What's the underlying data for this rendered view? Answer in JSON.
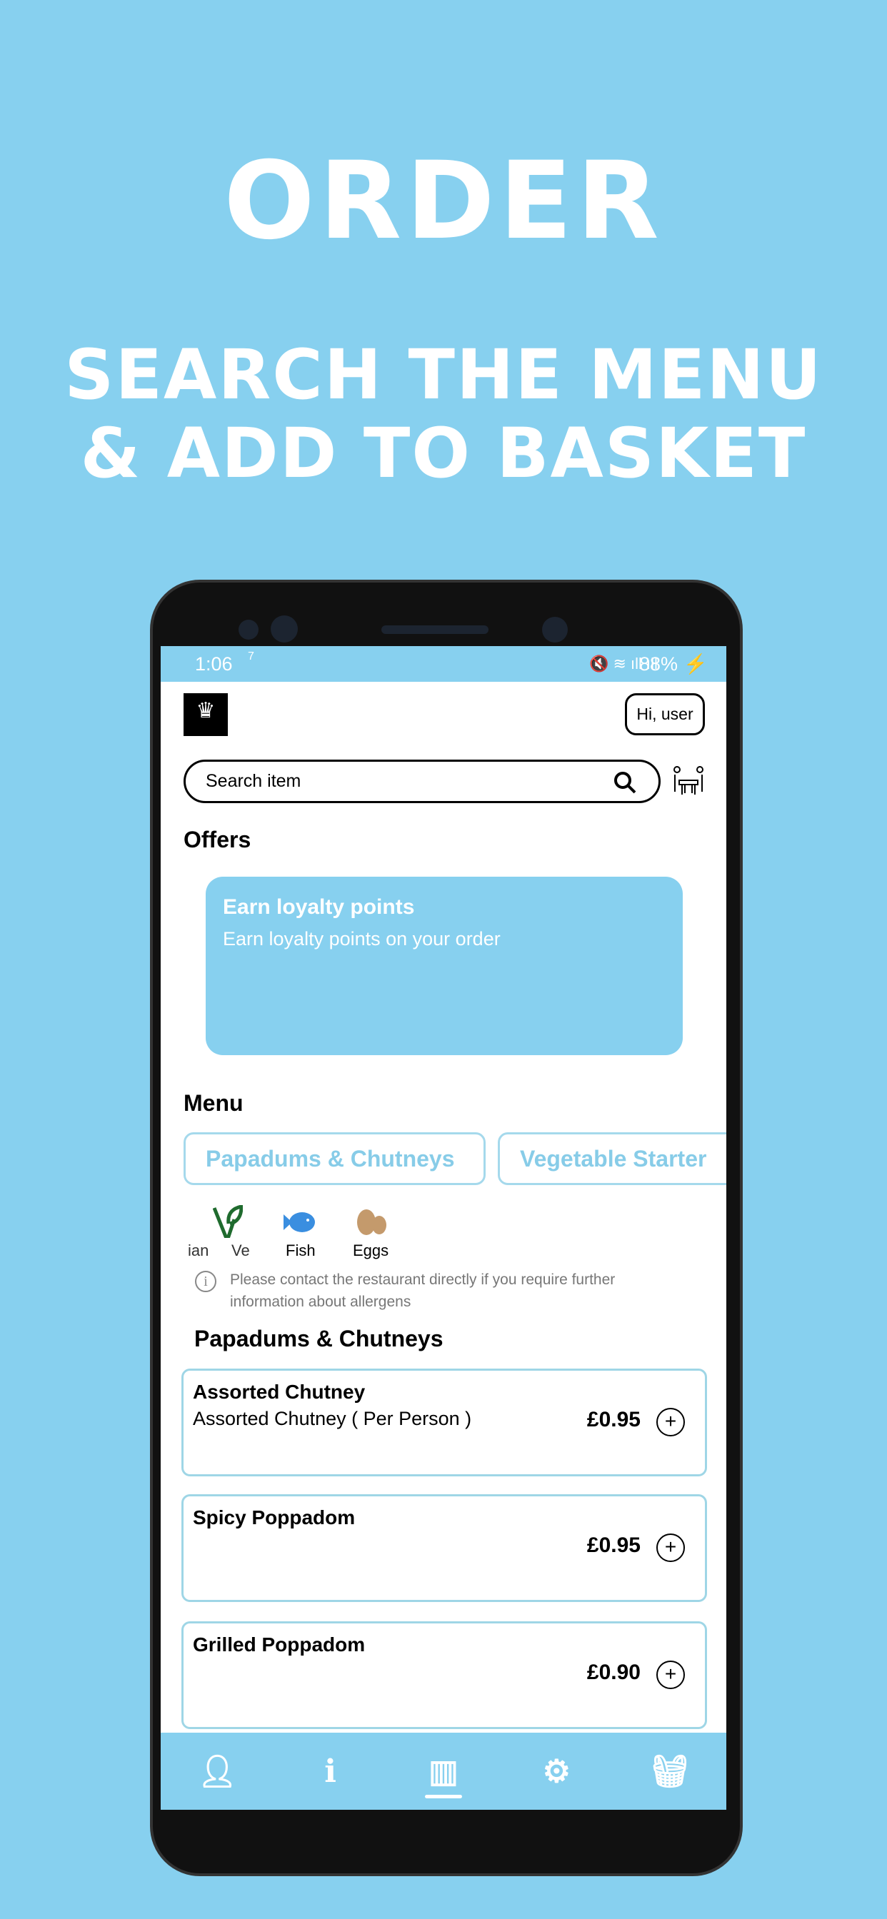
{
  "hero": {
    "title": "ORDER",
    "subtitle_line1": "SEARCH THE MENU",
    "subtitle_line2": "& ADD TO BASKET"
  },
  "status_bar": {
    "time": "1:06",
    "speed": "7",
    "battery": "88%"
  },
  "header": {
    "greeting": "Hi, user",
    "logo_icon": "crown-icon"
  },
  "search": {
    "placeholder": "Search item"
  },
  "offers": {
    "heading": "Offers",
    "card_title": "Earn loyalty points",
    "card_text": "Earn loyalty points on your order"
  },
  "menu": {
    "heading": "Menu",
    "categories": [
      {
        "label": "Papadums & Chutneys"
      },
      {
        "label": "Vegetable Starter"
      }
    ],
    "allergens": [
      {
        "label": "ian"
      },
      {
        "label": "Ve"
      },
      {
        "label": "Fish"
      },
      {
        "label": "Eggs"
      }
    ],
    "allergen_note": "Please contact the restaurant directly if you require further information about allergens",
    "section": "Papadums & Chutneys",
    "items": [
      {
        "name": "Assorted Chutney",
        "desc": "Assorted Chutney ( Per Person )",
        "price": "£0.95"
      },
      {
        "name": "Spicy Poppadom",
        "desc": "",
        "price": "£0.95"
      },
      {
        "name": "Grilled Poppadom",
        "desc": "",
        "price": "£0.90"
      }
    ]
  },
  "nav": {
    "items": [
      "profile-icon",
      "info-icon",
      "menu-icon",
      "settings-icon",
      "basket-icon"
    ],
    "active": "menu-icon"
  },
  "colors": {
    "accent": "#87d0ef"
  }
}
